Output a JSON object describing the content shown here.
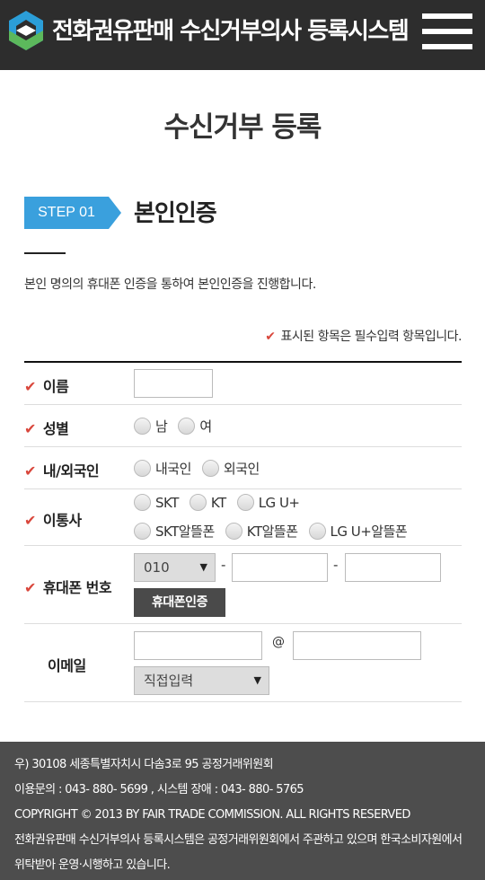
{
  "header": {
    "site_title": "전화권유판매 수신거부의사 등록시스템",
    "logo_icon": "diamond-logo-icon",
    "menu_icon": "hamburger-menu-icon",
    "colors": {
      "bg": "#2d2d2d",
      "logo_blue": "#2b9ed8",
      "logo_green": "#5cb85c"
    }
  },
  "page": {
    "title": "수신거부 등록"
  },
  "step": {
    "badge": "STEP 01",
    "title": "본인인증",
    "intro": "본인 명의의 휴대폰 인증을 통하여 본인인증을 진행합니다.",
    "required_note": "표시된 항목은 필수입력 항목입니다.",
    "accent_color": "#3aa0dd",
    "check_color": "#d9473c"
  },
  "form": {
    "name": {
      "label": "이름",
      "value": ""
    },
    "gender": {
      "label": "성별",
      "options": [
        "남",
        "여"
      ]
    },
    "nationality": {
      "label": "내/외국인",
      "options": [
        "내국인",
        "외국인"
      ]
    },
    "carrier": {
      "label": "이통사",
      "options_row1": [
        "SKT",
        "KT",
        "LG U+"
      ],
      "options_row2": [
        "SKT알뜰폰",
        "KT알뜰폰",
        "LG U+알뜰폰"
      ]
    },
    "phone": {
      "label": "휴대폰 번호",
      "prefix": "010",
      "separator": "-",
      "middle": "",
      "last": "",
      "verify_button": "휴대폰인증"
    },
    "email": {
      "label": "이메일",
      "local": "",
      "at": "@",
      "domain": "",
      "domain_select": "직접입력"
    }
  },
  "footer": {
    "address": "우) 30108 세종특별자치시 다솜3로 95 공정거래위원회",
    "contact": "이용문의 : 043- 880- 5699 , 시스템 장애 : 043- 880- 5765",
    "copyright": "COPYRIGHT © 2013 BY FAIR TRADE COMMISSION. ALL RIGHTS RESERVED",
    "notice": "전화권유판매 수신거부의사 등록시스템은 공정거래위원회에서 주관하고 있으며 한국소비자원에서 위탁받아 운영·시행하고 있습니다."
  }
}
